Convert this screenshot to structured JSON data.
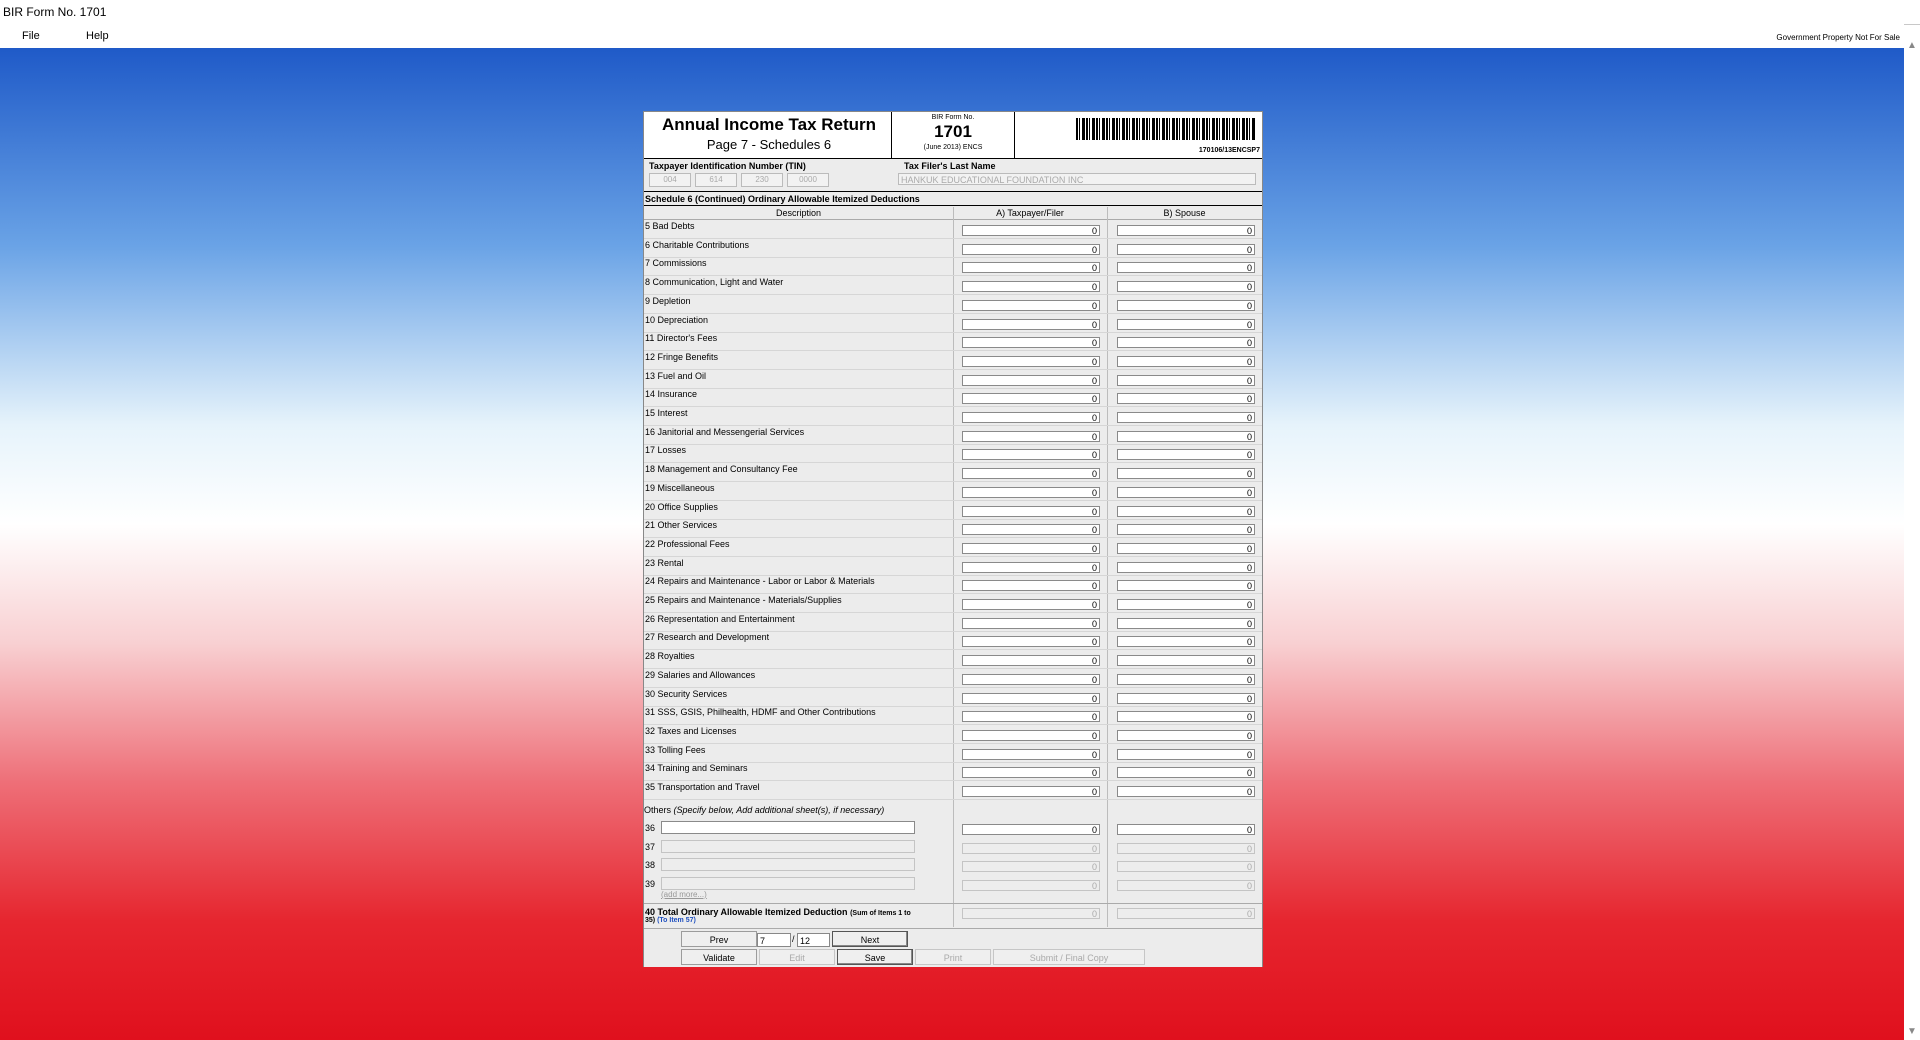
{
  "window": {
    "title": "BIR Form No. 1701"
  },
  "menu": {
    "file": "File",
    "help": "Help",
    "notice": "Government Property Not For Sale"
  },
  "header": {
    "title": "Annual Income Tax Return",
    "subtitle": "Page 7 - Schedules 6",
    "form_no_label": "BIR Form No.",
    "form_no": "1701",
    "version": "(June 2013) ENCS",
    "barcode_code": "170106/13ENCSP7"
  },
  "taxpayer": {
    "tin_label": "Taxpayer Identification Number (TIN)",
    "tin": [
      "004",
      "614",
      "230",
      "0000"
    ],
    "last_name_label": "Tax Filer's Last Name",
    "last_name": "HANKUK EDUCATIONAL FOUNDATION INC"
  },
  "schedule": {
    "title": "Schedule 6 (Continued) Ordinary Allowable Itemized Deductions",
    "col_desc": "Description",
    "col_a": "A) Taxpayer/Filer",
    "col_b": "B) Spouse"
  },
  "items": [
    {
      "label": "5 Bad Debts",
      "a": "0",
      "b": "0"
    },
    {
      "label": "6 Charitable Contributions",
      "a": "0",
      "b": "0"
    },
    {
      "label": "7 Commissions",
      "a": "0",
      "b": "0"
    },
    {
      "label": "8 Communication, Light and Water",
      "a": "0",
      "b": "0"
    },
    {
      "label": "9 Depletion",
      "a": "0",
      "b": "0"
    },
    {
      "label": "10 Depreciation",
      "a": "0",
      "b": "0"
    },
    {
      "label": "11 Director's Fees",
      "a": "0",
      "b": "0"
    },
    {
      "label": "12 Fringe Benefits",
      "a": "0",
      "b": "0"
    },
    {
      "label": "13 Fuel and Oil",
      "a": "0",
      "b": "0"
    },
    {
      "label": "14 Insurance",
      "a": "0",
      "b": "0"
    },
    {
      "label": "15 Interest",
      "a": "0",
      "b": "0"
    },
    {
      "label": "16 Janitorial and Messengerial Services",
      "a": "0",
      "b": "0"
    },
    {
      "label": "17 Losses",
      "a": "0",
      "b": "0"
    },
    {
      "label": "18 Management and Consultancy Fee",
      "a": "0",
      "b": "0"
    },
    {
      "label": "19 Miscellaneous",
      "a": "0",
      "b": "0"
    },
    {
      "label": "20 Office Supplies",
      "a": "0",
      "b": "0"
    },
    {
      "label": "21 Other Services",
      "a": "0",
      "b": "0"
    },
    {
      "label": "22 Professional Fees",
      "a": "0",
      "b": "0"
    },
    {
      "label": "23 Rental",
      "a": "0",
      "b": "0"
    },
    {
      "label": "24 Repairs and Maintenance - Labor or Labor & Materials",
      "a": "0",
      "b": "0"
    },
    {
      "label": "25 Repairs and Maintenance - Materials/Supplies",
      "a": "0",
      "b": "0"
    },
    {
      "label": "26 Representation and Entertainment",
      "a": "0",
      "b": "0"
    },
    {
      "label": "27 Research and Development",
      "a": "0",
      "b": "0"
    },
    {
      "label": "28 Royalties",
      "a": "0",
      "b": "0"
    },
    {
      "label": "29 Salaries and Allowances",
      "a": "0",
      "b": "0"
    },
    {
      "label": "30 Security Services",
      "a": "0",
      "b": "0"
    },
    {
      "label": "31 SSS, GSIS, Philhealth, HDMF and Other Contributions",
      "a": "0",
      "b": "0"
    },
    {
      "label": "32 Taxes and Licenses",
      "a": "0",
      "b": "0"
    },
    {
      "label": "33 Tolling Fees",
      "a": "0",
      "b": "0"
    },
    {
      "label": "34 Training and Seminars",
      "a": "0",
      "b": "0"
    },
    {
      "label": "35 Transportation and Travel",
      "a": "0",
      "b": "0"
    }
  ],
  "others": {
    "label": "Others",
    "hint": "(Specify below, Add additional sheet(s), if necessary)",
    "rows": [
      {
        "num": "36",
        "a": "0",
        "b": "0"
      },
      {
        "num": "37",
        "a": "0",
        "b": "0"
      },
      {
        "num": "38",
        "a": "0",
        "b": "0"
      },
      {
        "num": "39",
        "a": "0",
        "b": "0"
      }
    ],
    "add_more": "(add more...)"
  },
  "total": {
    "label": "40 Total Ordinary Allowable Itemized Deduction",
    "note1": "(Sum of Items 1 to",
    "note2": "35)",
    "to_item": "(To Item 57)",
    "a": "0",
    "b": "0"
  },
  "nav": {
    "prev": "Prev",
    "next": "Next",
    "page": "7",
    "sep": "/",
    "total_pages": "12",
    "validate": "Validate",
    "edit": "Edit",
    "save": "Save",
    "print": "Print",
    "submit": "Submit / Final Copy"
  }
}
